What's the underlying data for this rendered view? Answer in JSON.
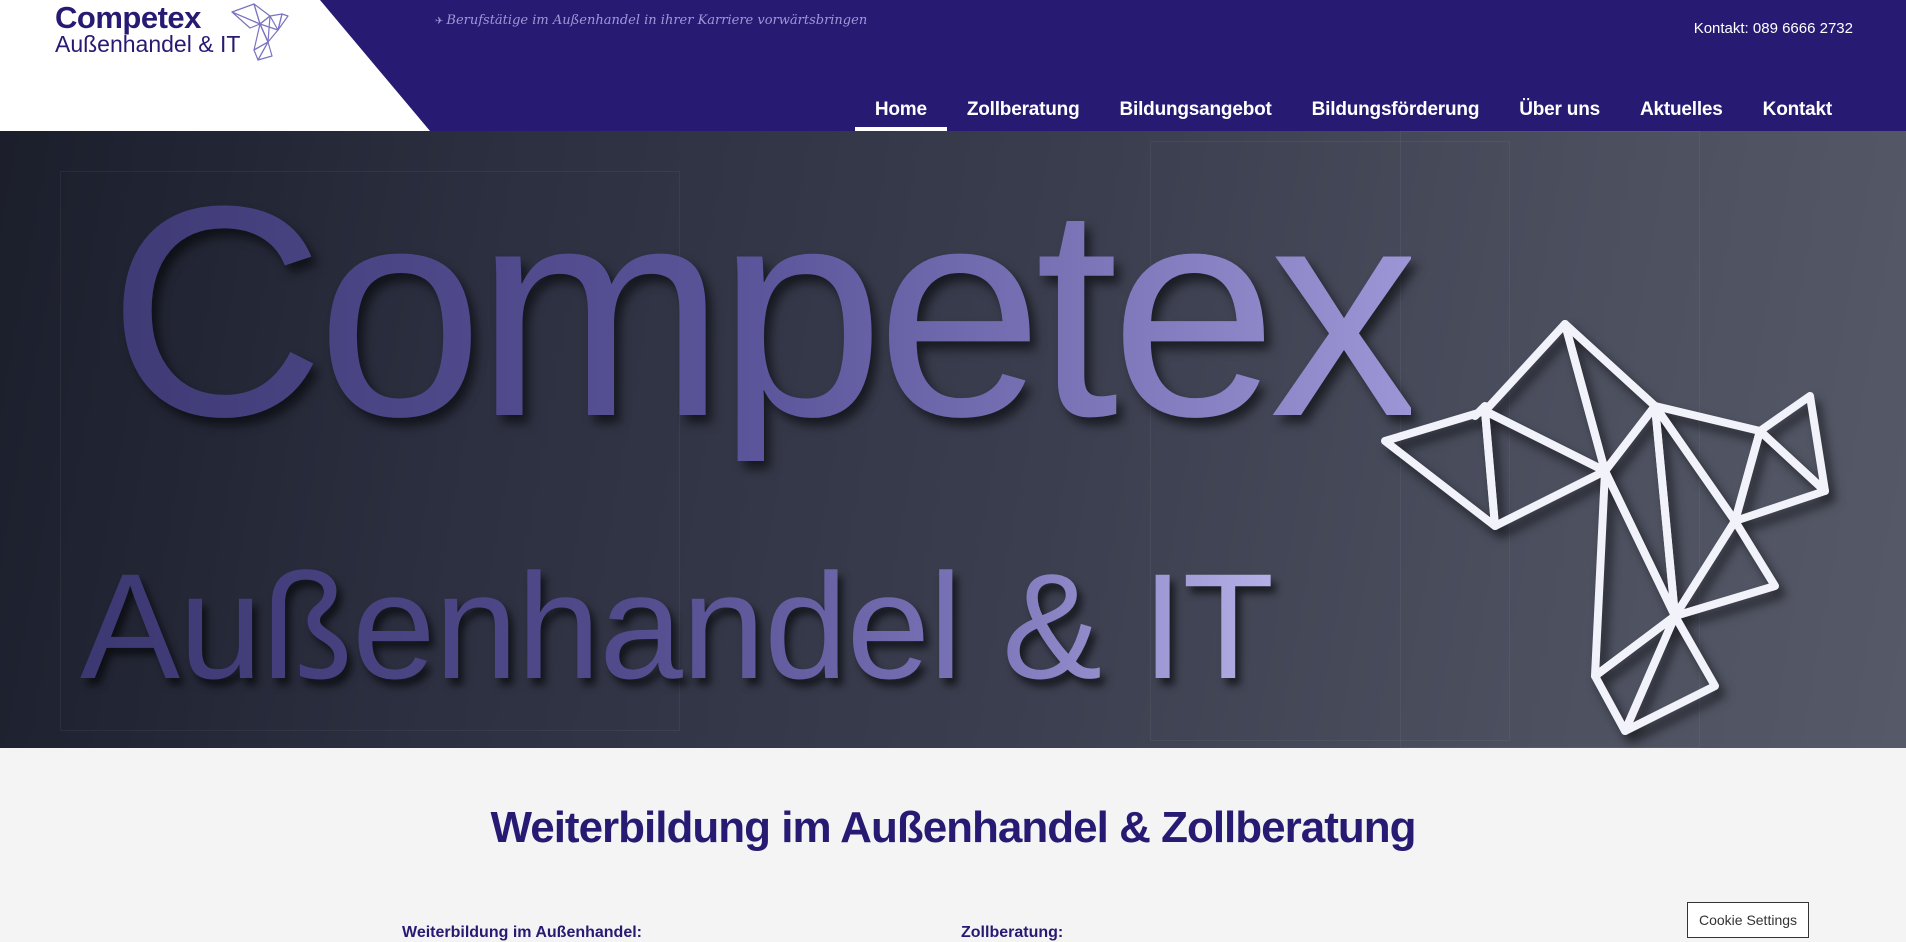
{
  "header": {
    "logo_title": "Competex",
    "logo_subtitle": "Außenhandel & IT",
    "tagline": "Berufstätige im Außenhandel in ihrer Karriere vorwärtsbringen",
    "tagline_icon": "plane-icon",
    "contact": "Kontakt: 089 6666 2732"
  },
  "nav": {
    "items": [
      {
        "label": "Home",
        "active": true
      },
      {
        "label": "Zollberatung",
        "active": false
      },
      {
        "label": "Bildungsangebot",
        "active": false
      },
      {
        "label": "Bildungsförderung",
        "active": false
      },
      {
        "label": "Über uns",
        "active": false
      },
      {
        "label": "Aktuelles",
        "active": false
      },
      {
        "label": "Kontakt",
        "active": false
      }
    ]
  },
  "hero": {
    "line1": "Competex",
    "line2": "Außenhandel & IT",
    "graphic": "origami-bird-icon"
  },
  "content": {
    "title": "Weiterbildung im Außenhandel & Zollberatung",
    "left_heading": "Weiterbildung im Außenhandel:",
    "right_heading": "Zollberatung:"
  },
  "cookie": {
    "label": "Cookie Settings"
  },
  "colors": {
    "brand": "#271a73",
    "tagline": "#9e98d8",
    "background": "#f4f4f4"
  }
}
